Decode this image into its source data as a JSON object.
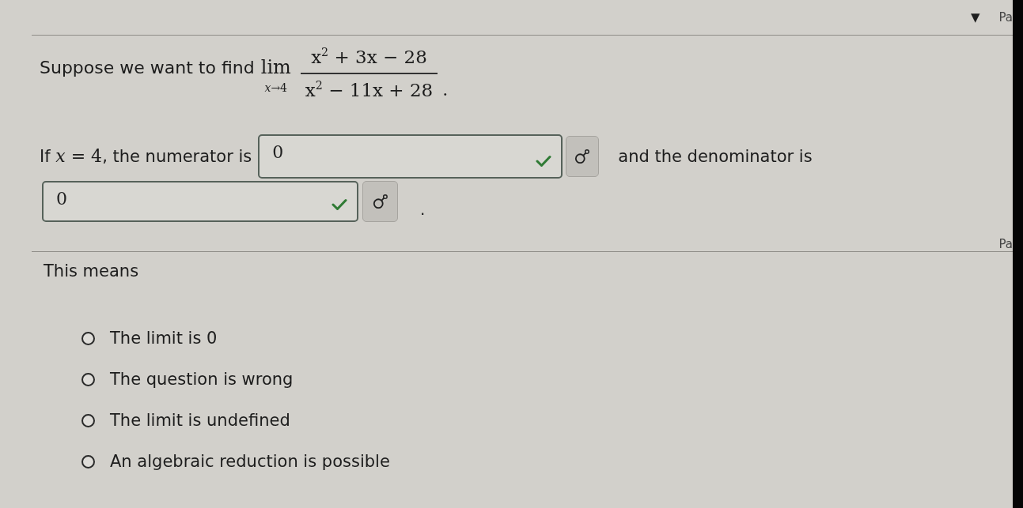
{
  "top_bar": {
    "arrow": "▼",
    "label": "Pa"
  },
  "question": {
    "intro": "Suppose we want to find",
    "limit": {
      "operator": "lim",
      "approach": "*x*→4",
      "numerator": "x$^{2}$ + 3x − 28",
      "denominator": "x$^{2}$ − 11x + 28"
    },
    "end": "."
  },
  "part_1": {
    "lead": {
      "before": "If",
      "math": "*x* = 4",
      "after": ", the numerator is"
    },
    "numerator_answer": {
      "value": "0",
      "correct": true
    },
    "middle": "and the denominator is",
    "denominator_answer": {
      "value": "0",
      "correct": true
    },
    "end": "."
  },
  "part_2": {
    "label": "Pa",
    "intro": "This means",
    "options": [
      {
        "label": "The limit is 0",
        "selected": false
      },
      {
        "label": "The question is wrong",
        "selected": false
      },
      {
        "label": "The limit is undefined",
        "selected": false
      },
      {
        "label": "An algebraic reduction is possible",
        "selected": false
      }
    ]
  }
}
